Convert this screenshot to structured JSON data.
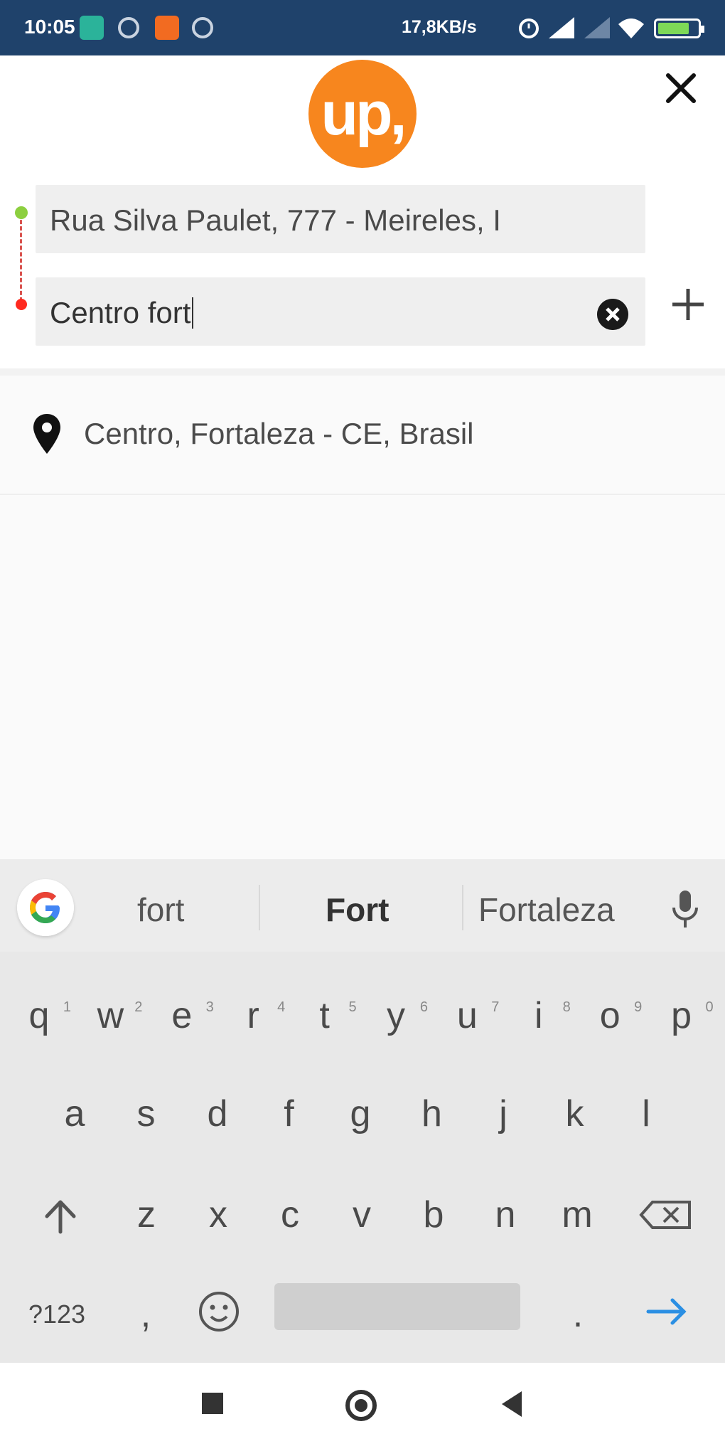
{
  "status_bar": {
    "time": "10:05",
    "network_rate": "17,8KB/s",
    "battery_level": 0.8,
    "battery_color": "#7ed957",
    "icons": [
      "mail-icon",
      "sync-icon",
      "app-icon",
      "sync-icon",
      "alarm-icon",
      "signal-icon",
      "signal-icon",
      "wifi-icon",
      "battery-icon"
    ]
  },
  "header": {
    "logo_text": "up,",
    "brand_color": "#f7861e",
    "close_icon": "close-icon"
  },
  "route": {
    "origin_value": "Rua Silva Paulet, 777 - Meireles, I",
    "destination_value": "Centro fort",
    "origin_dot_color": "#8ccf3f",
    "destination_dot_color": "#ff2a1f",
    "clear_icon": "clear-icon",
    "add_icon": "plus-icon"
  },
  "results": [
    {
      "icon": "location-pin-icon",
      "label": "Centro, Fortaleza - CE, Brasil"
    }
  ],
  "keyboard": {
    "suggestions": [
      "fort",
      "Fort",
      "Fortaleza"
    ],
    "row1": [
      {
        "k": "q",
        "h": "1"
      },
      {
        "k": "w",
        "h": "2"
      },
      {
        "k": "e",
        "h": "3"
      },
      {
        "k": "r",
        "h": "4"
      },
      {
        "k": "t",
        "h": "5"
      },
      {
        "k": "y",
        "h": "6"
      },
      {
        "k": "u",
        "h": "7"
      },
      {
        "k": "i",
        "h": "8"
      },
      {
        "k": "o",
        "h": "9"
      },
      {
        "k": "p",
        "h": "0"
      }
    ],
    "row2": [
      "a",
      "s",
      "d",
      "f",
      "g",
      "h",
      "j",
      "k",
      "l"
    ],
    "row3": [
      "z",
      "x",
      "c",
      "v",
      "b",
      "n",
      "m"
    ],
    "symbols_key": "?123",
    "comma_key": ",",
    "period_key": ".",
    "enter_color": "#2b8fe3"
  }
}
